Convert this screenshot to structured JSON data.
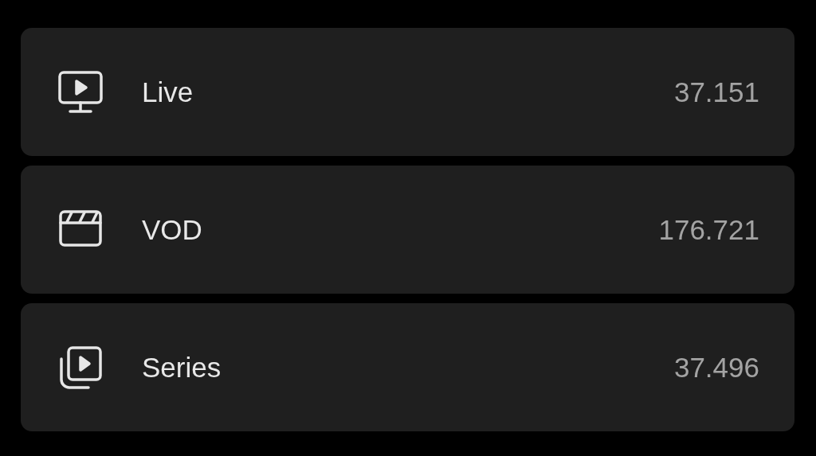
{
  "categories": [
    {
      "kind": "live",
      "label": "Live",
      "count": "37.151"
    },
    {
      "kind": "vod",
      "label": "VOD",
      "count": "176.721"
    },
    {
      "kind": "series",
      "label": "Series",
      "count": "37.496"
    }
  ]
}
